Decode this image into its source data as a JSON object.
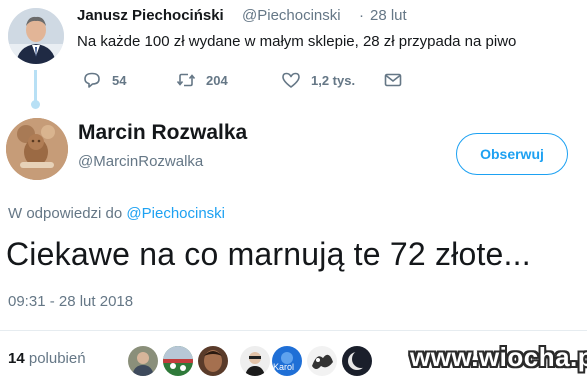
{
  "parent_tweet": {
    "author_name": "Janusz Piechociński",
    "handle": "@Piechocinski",
    "separator": "·",
    "date": "28 lut",
    "text": "Na każde 100 zł wydane w małym sklepie, 28 zł przypada na piwo",
    "actions": {
      "replies": "54",
      "retweets": "204",
      "likes": "1,2 tys."
    }
  },
  "main_tweet": {
    "author_name": "Marcin Rozwalka",
    "handle": "@MarcinRozwalka",
    "follow_label": "Obserwuj",
    "reply_prefix": "W odpowiedzi do",
    "reply_to": "@Piechocinski",
    "text": "Ciekawe na co marnują te 72 złote...",
    "timestamp": "09:31 - 28 lut 2018",
    "likes_count": "14",
    "likes_label": "polubień",
    "liker_avatar_caption": "Karol"
  },
  "watermark": "www.wiocha.pl",
  "colors": {
    "accent": "#1da1f2",
    "text": "#14171a",
    "secondary": "#657786",
    "thread_line": "#b8e0f5"
  }
}
